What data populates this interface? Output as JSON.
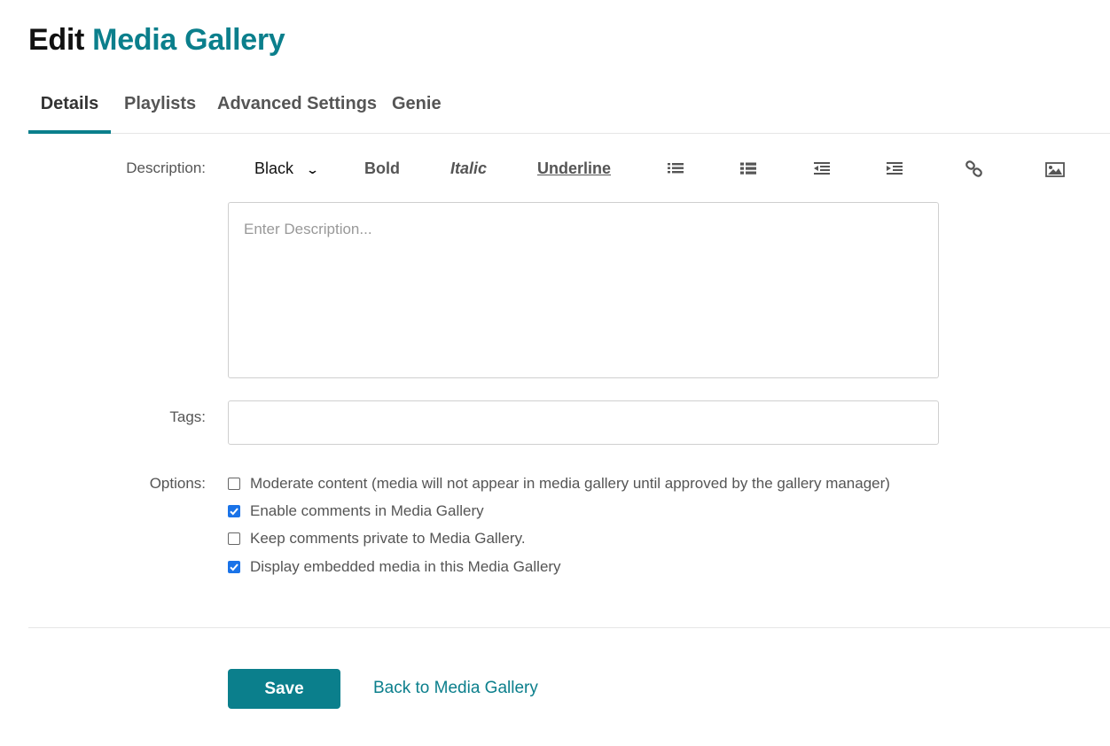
{
  "header": {
    "title_prefix": "Edit",
    "title_name": "Media Gallery"
  },
  "tabs": [
    {
      "label": "Details",
      "active": true
    },
    {
      "label": "Playlists",
      "active": false
    },
    {
      "label": "Advanced Settings",
      "active": false
    },
    {
      "label": "Genie",
      "active": false
    }
  ],
  "form": {
    "description_label": "Description:",
    "toolbar": {
      "color_label": "Black",
      "bold_label": "Bold",
      "italic_label": "Italic",
      "underline_label": "Underline",
      "icons": [
        "unordered-list-icon",
        "ordered-list-icon",
        "outdent-icon",
        "indent-icon",
        "link-icon",
        "image-icon"
      ]
    },
    "description_placeholder": "Enter Description...",
    "description_value": "",
    "tags_label": "Tags:",
    "tags_value": "",
    "options_label": "Options:",
    "options": [
      {
        "label": "Moderate content (media will not appear in media gallery until approved by the gallery manager)",
        "checked": false
      },
      {
        "label": "Enable comments in Media Gallery",
        "checked": true
      },
      {
        "label": "Keep comments private to Media Gallery.",
        "checked": false
      },
      {
        "label": "Display embedded media in this Media Gallery",
        "checked": true
      }
    ]
  },
  "actions": {
    "save_label": "Save",
    "back_label": "Back to Media Gallery"
  },
  "colors": {
    "accent": "#0b7f8c",
    "checkbox_checked": "#1a73e8"
  }
}
